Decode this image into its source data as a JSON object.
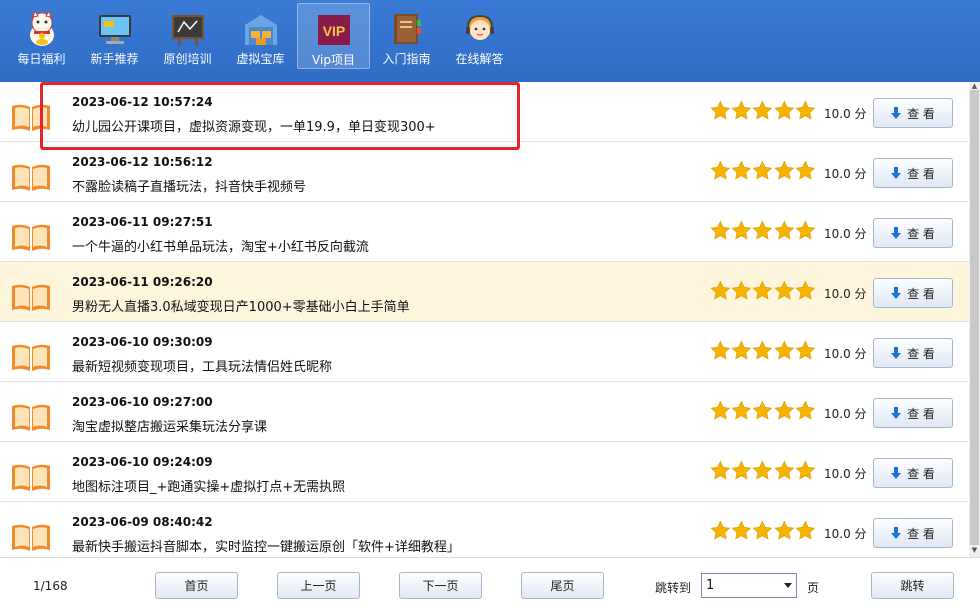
{
  "toolbar": {
    "items": [
      {
        "label": "每日福利",
        "icon": "lucky-cat-icon"
      },
      {
        "label": "新手推荐",
        "icon": "monitor-icon"
      },
      {
        "label": "原创培训",
        "icon": "chalkboard-icon"
      },
      {
        "label": "虚拟宝库",
        "icon": "warehouse-icon"
      },
      {
        "label": "Vip项目",
        "icon": "vip-badge-icon",
        "badge": "VIP",
        "active": true
      },
      {
        "label": "入门指南",
        "icon": "guide-book-icon"
      },
      {
        "label": "在线解答",
        "icon": "support-agent-icon"
      }
    ]
  },
  "list": {
    "rows": [
      {
        "time": "2023-06-12 10:57:24",
        "title": "幼儿园公开课项目，虚拟资源变现，一单19.9，单日变现300+",
        "rating": 5,
        "score": "10.0 分",
        "button": "查 看"
      },
      {
        "time": "2023-06-12 10:56:12",
        "title": "不露脸读稿子直播玩法，抖音快手视频号",
        "rating": 5,
        "score": "10.0 分",
        "button": "查 看"
      },
      {
        "time": "2023-06-11 09:27:51",
        "title": "一个牛逼的小红书单品玩法，淘宝+小红书反向截流",
        "rating": 5,
        "score": "10.0 分",
        "button": "查 看"
      },
      {
        "time": "2023-06-11 09:26:20",
        "title": "男粉无人直播3.0私域变现日产1000+零基础小白上手简单",
        "rating": 5,
        "score": "10.0 分",
        "button": "查 看",
        "highlighted": true
      },
      {
        "time": "2023-06-10 09:30:09",
        "title": "最新短视频变现项目，工具玩法情侣姓氏昵称",
        "rating": 5,
        "score": "10.0 分",
        "button": "查 看"
      },
      {
        "time": "2023-06-10 09:27:00",
        "title": "淘宝虚拟整店搬运采集玩法分享课",
        "rating": 5,
        "score": "10.0 分",
        "button": "查 看"
      },
      {
        "time": "2023-06-10 09:24:09",
        "title": "地图标注项目_+跑通实操+虚拟打点+无需执照",
        "rating": 5,
        "score": "10.0 分",
        "button": "查 看"
      },
      {
        "time": "2023-06-09 08:40:42",
        "title": "最新快手搬运抖音脚本，实时监控一键搬运原创「软件+详细教程」",
        "rating": 5,
        "score": "10.0 分",
        "button": "查 看"
      }
    ]
  },
  "pagination": {
    "info": "1/168",
    "first": "首页",
    "prev": "上一页",
    "next": "下一页",
    "last": "尾页",
    "jump_label": "跳转到",
    "jump_value": "1",
    "unit": "页",
    "jump_button": "跳转"
  },
  "colors": {
    "toolbar": "#2f6cc6",
    "star": "#f5b400",
    "highlight_row": "#fdf6dc",
    "annotation_frame": "#e3262b"
  }
}
